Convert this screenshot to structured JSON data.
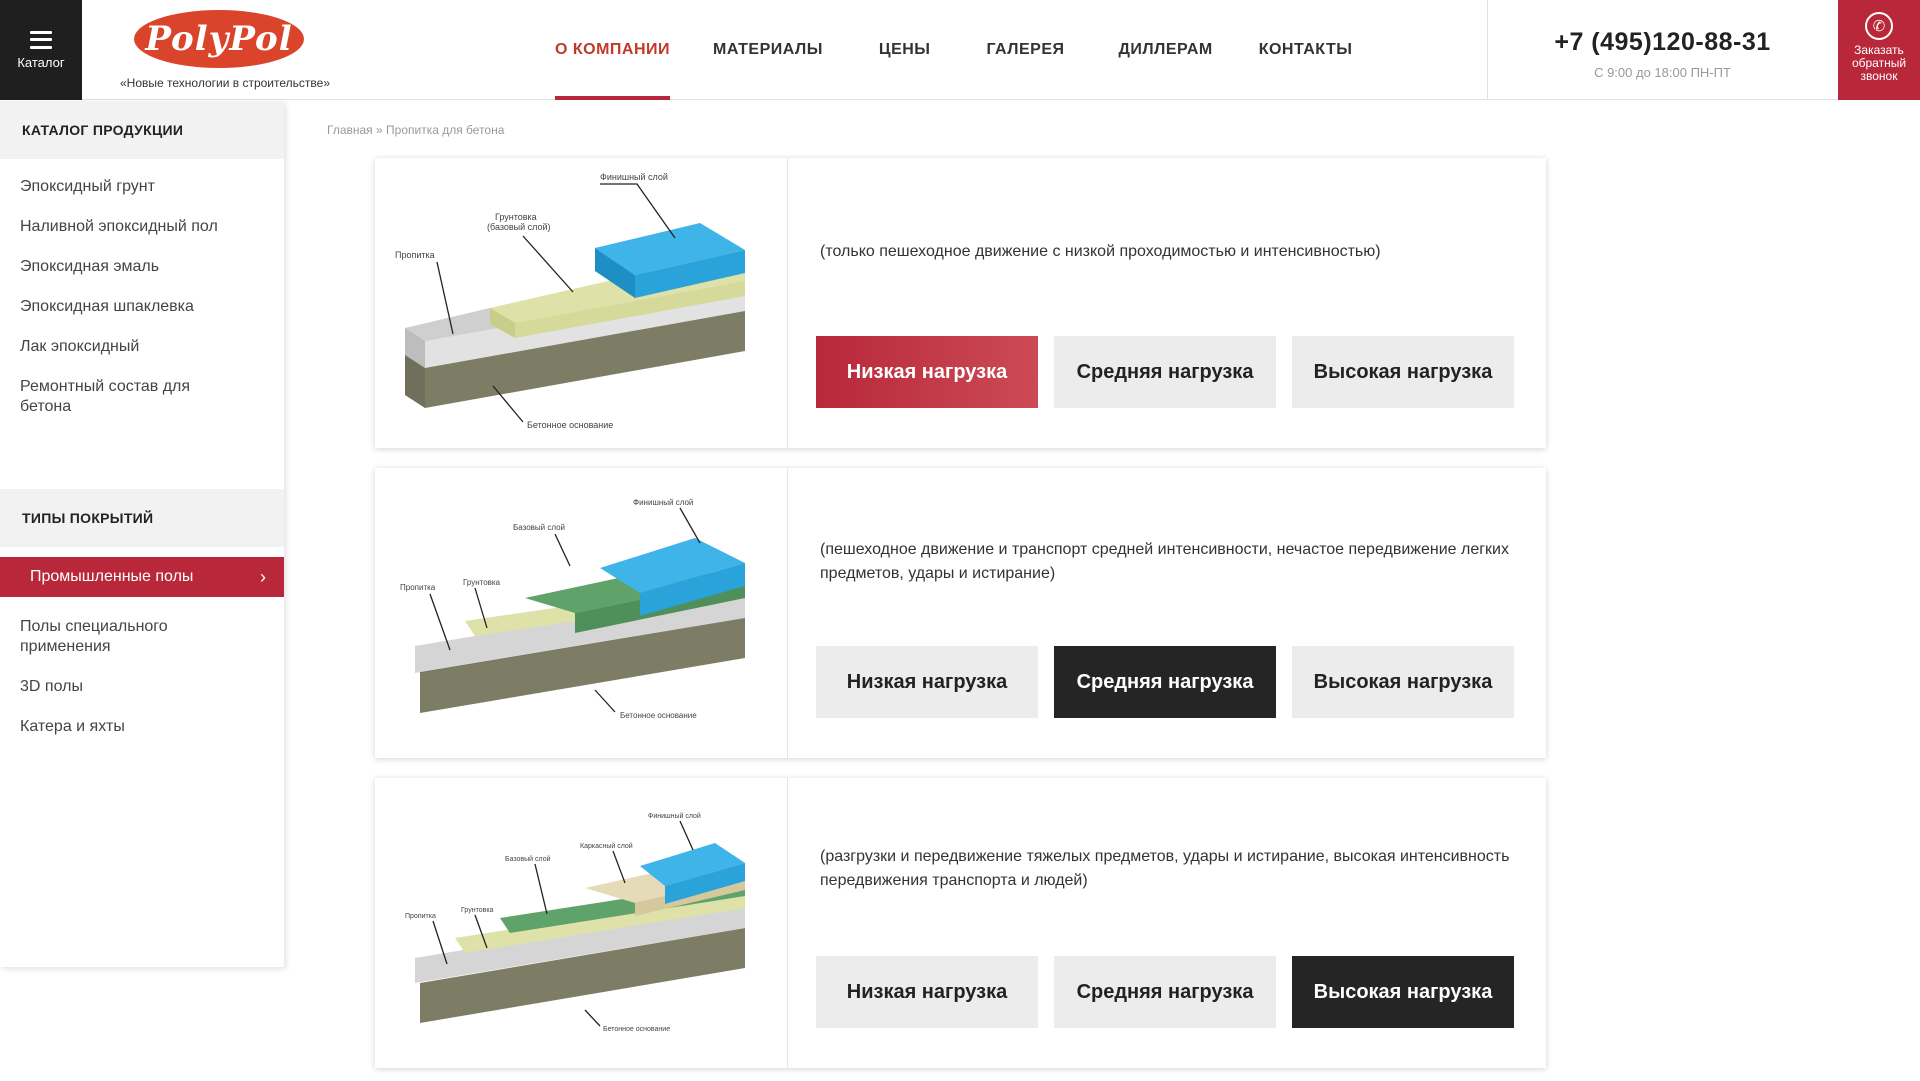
{
  "header": {
    "catalog_label": "Каталог",
    "logo_text": "PolyPol",
    "tagline": "«Новые технологии в строительстве»",
    "nav": [
      "О КОМПАНИИ",
      "МАТЕРИАЛЫ",
      "ЦЕНЫ",
      "ГАЛЕРЕЯ",
      "ДИЛЛЕРАМ",
      "КОНТАКТЫ"
    ],
    "phone": "+7 (495)120-88-31",
    "hours": "С 9:00 до 18:00 ПН-ПТ",
    "callback": [
      "Заказать",
      "обратный",
      "звонок"
    ]
  },
  "sidebar": {
    "catalog_title": "КАТАЛОГ ПРОДУКЦИИ",
    "catalog_items": [
      "Эпоксидный грунт",
      "Наливной эпоксидный пол",
      "Эпоксидная эмаль",
      "Эпоксидная шпаклевка",
      "Лак эпоксидный",
      "Ремонтный состав для бетона"
    ],
    "types_title": "ТИПЫ ПОКРЫТИЙ",
    "types_items": [
      "Промышленные полы",
      "Полы специального применения",
      "3D полы",
      "Катера и яхты"
    ]
  },
  "breadcrumb": {
    "home": "Главная",
    "sep": " » ",
    "current": "Пропитка для бетона"
  },
  "cards": [
    {
      "description": "(только пешеходное движение   с низкой проходимостью и интенсивностью)",
      "layers": {
        "impregnation": "Пропитка",
        "primer": "Грунтовка",
        "primer_sub": "(базовый слой)",
        "finish": "Финишный слой",
        "base": "Бетонное основание"
      }
    },
    {
      "description": "(пешеходное движение и транспорт средней интенсивности, нечастое передвижение легких предметов, удары и истирание)",
      "layers": {
        "impregnation": "Пропитка",
        "primer": "Грунтовка",
        "base_layer": "Базовый слой",
        "finish": "Финишный слой",
        "base": "Бетонное основание"
      }
    },
    {
      "description": "(разгрузки и передвижение тяжелых предметов, удары и истирание, высокая интенсивность передвижения транспорта и людей)",
      "layers": {
        "impregnation": "Пропитка",
        "primer": "Грунтовка",
        "base_layer": "Базовый слой",
        "frame": "Каркасный слой",
        "finish": "Финишный слой",
        "base": "Бетонное основание"
      }
    }
  ],
  "load_buttons": [
    "Низкая нагрузка",
    "Средняя нагрузка",
    "Высокая нагрузка"
  ],
  "colors": {
    "accent_red": "#b8283a",
    "dark": "#252525",
    "light_btn": "#ececec",
    "finish_blue": "#2aa7e0",
    "base_green": "#5fa26a",
    "primer_yellow": "#d9dfa6"
  }
}
